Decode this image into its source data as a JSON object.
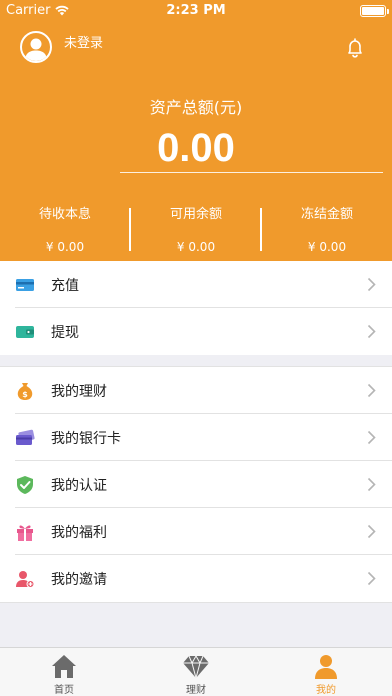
{
  "status_bar": {
    "carrier": "Carrier",
    "time": "2:23 PM"
  },
  "header": {
    "login_text": "未登录",
    "total_label": "资产总额(元)",
    "total_value": "0.00",
    "stats": [
      {
        "label": "待收本息",
        "value": "¥ 0.00"
      },
      {
        "label": "可用余额",
        "value": "¥ 0.00"
      },
      {
        "label": "冻结金额",
        "value": "¥ 0.00"
      }
    ]
  },
  "group1": [
    {
      "label": "充值",
      "icon": "credit-card-icon"
    },
    {
      "label": "提现",
      "icon": "wallet-icon"
    }
  ],
  "group2": [
    {
      "label": "我的理财",
      "icon": "money-bag-icon"
    },
    {
      "label": "我的银行卡",
      "icon": "bank-card-icon"
    },
    {
      "label": "我的认证",
      "icon": "shield-check-icon"
    },
    {
      "label": "我的福利",
      "icon": "gift-icon"
    },
    {
      "label": "我的邀请",
      "icon": "invite-user-icon"
    }
  ],
  "tabs": [
    {
      "label": "首页",
      "icon": "home-icon"
    },
    {
      "label": "理财",
      "icon": "diamond-icon"
    },
    {
      "label": "我的",
      "icon": "profile-icon"
    }
  ],
  "colors": {
    "accent": "#f09a2c",
    "background": "#efeff4"
  }
}
